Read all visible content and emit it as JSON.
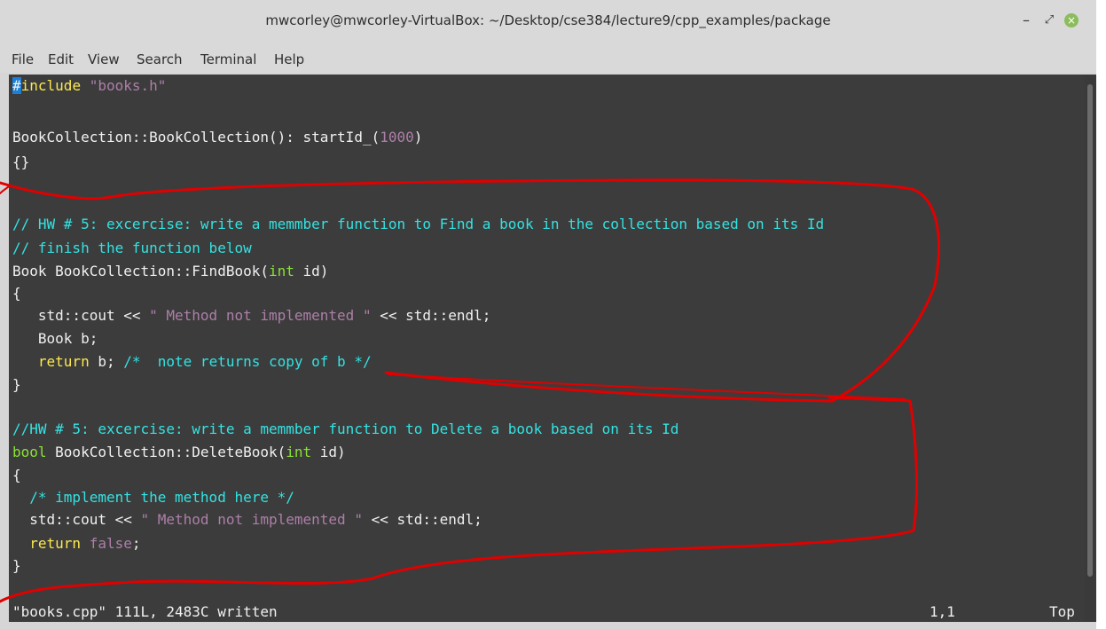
{
  "window": {
    "title": "mwcorley@mwcorley-VirtualBox: ~/Desktop/cse384/lecture9/cpp_examples/package",
    "controls": {
      "minimize": "–",
      "maximize": "⤢",
      "close": "×"
    }
  },
  "menu": [
    "File",
    "Edit",
    "View",
    "Search",
    "Terminal",
    "Help"
  ],
  "code": {
    "l1_cursor": "#",
    "l1_rest": "include ",
    "l1_str": "\"books.h\"",
    "l3_a": "BookCollection::BookCollection(): startId_(",
    "l3_num": "1000",
    "l3_b": ")",
    "l4": "{}",
    "l7": "// HW # 5: excercise: write a memmber function to Find a book in the collection based on its Id",
    "l8": "// finish the function below",
    "l9_a": "Book BookCollection::FindBook(",
    "l9_kw": "int",
    "l9_b": " id)",
    "l10": "{",
    "l11_a": "   std::cout << ",
    "l11_str": "\" Method not implemented \"",
    "l11_b": " << std::endl;",
    "l12": "   Book b;",
    "l13_ret": "   return",
    "l13_b": " b; ",
    "l13_cmt": "/*  note returns copy of b */",
    "l14": "}",
    "l16": "//HW # 5: excercise: write a memmber function to Delete a book based on its Id",
    "l17_kw": "bool",
    "l17_a": " BookCollection::DeleteBook(",
    "l17_kw2": "int",
    "l17_b": " id)",
    "l18": "{",
    "l19": "  /* implement the method here */",
    "l20_a": "  std::cout << ",
    "l20_str": "\" Method not implemented \"",
    "l20_b": " << std::endl;",
    "l21_ret": "  return",
    "l21_false": " false",
    "l21_b": ";",
    "l22": "}"
  },
  "statusbar": {
    "message": "\"books.cpp\" 111L, 2483C written",
    "position": "1,1",
    "scroll": "Top"
  },
  "colors": {
    "background": "#3c3c3c",
    "text": "#f0f0f0",
    "comment": "#34e2e2",
    "string": "#ad7fa8",
    "type_keyword": "#8ae234",
    "statement": "#fce94f",
    "cursor": "#1a7fd8",
    "annotation": "#e00000"
  }
}
